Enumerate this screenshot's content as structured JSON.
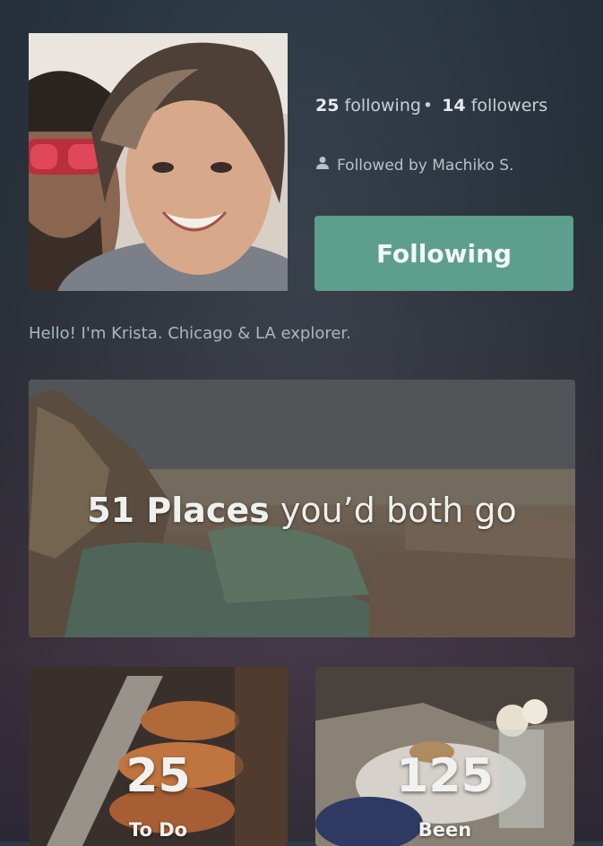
{
  "profile": {
    "following_count": "25",
    "following_label": "following",
    "separator": "•",
    "followers_count": "14",
    "followers_label": "followers",
    "followed_by": "Followed by Machiko S.",
    "follow_button": "Following",
    "bio": "Hello! I'm Krista. Chicago & LA explorer."
  },
  "shared": {
    "count_text": "51 Places",
    "suffix_text": " you’d both go"
  },
  "tiles": [
    {
      "count": "25",
      "label": "To Do"
    },
    {
      "count": "125",
      "label": "Been"
    }
  ],
  "colors": {
    "accent": "#5d9e8d",
    "background": "#2f3944"
  },
  "icons": {
    "followed_by": "person-icon"
  }
}
